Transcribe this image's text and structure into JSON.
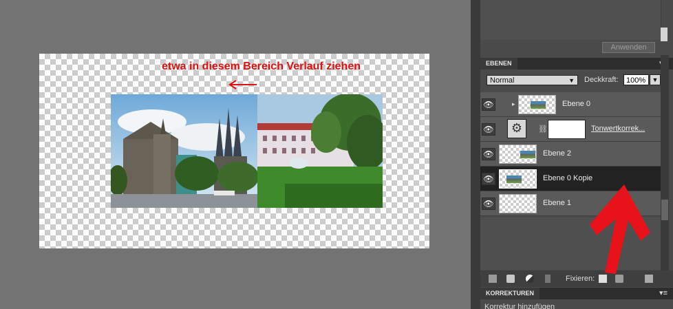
{
  "annotation": {
    "canvas_text": "etwa in diesem Bereich Verlauf ziehen",
    "color": "#e01010"
  },
  "panel": {
    "apply_button": "Anwenden",
    "layers_tab": "EBENEN",
    "blend_mode": "Normal",
    "opacity_label": "Deckkraft:",
    "opacity_value": "100%",
    "layers": [
      {
        "name": "Ebene 0"
      },
      {
        "name": "Tonwertkorrek..."
      },
      {
        "name": "Ebene 2"
      },
      {
        "name": "Ebene 0 Kopie"
      },
      {
        "name": "Ebene 1"
      }
    ],
    "fix_label": "Fixieren:",
    "corrections_tab": "KORREKTUREN",
    "corrections_text": "Korrektur hinzufügen"
  }
}
